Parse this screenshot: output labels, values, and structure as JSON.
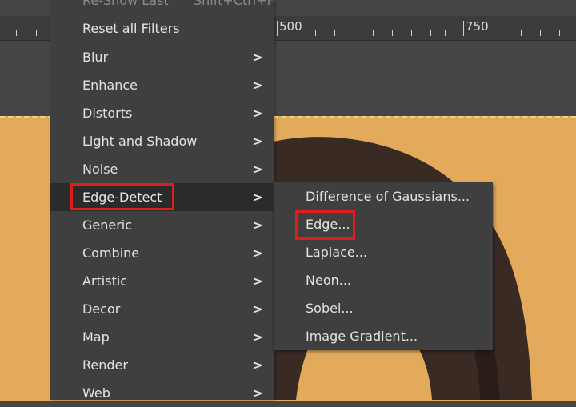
{
  "ruler": {
    "labels": [
      "500",
      "750"
    ]
  },
  "filters_menu": {
    "top_item": {
      "label": "Re-Show Last",
      "shortcut": "Shift+Ctrl+F"
    },
    "reset_label": "Reset all Filters",
    "items": [
      {
        "label": "Blur"
      },
      {
        "label": "Enhance"
      },
      {
        "label": "Distorts"
      },
      {
        "label": "Light and Shadow"
      },
      {
        "label": "Noise"
      },
      {
        "label": "Edge-Detect"
      },
      {
        "label": "Generic"
      },
      {
        "label": "Combine"
      },
      {
        "label": "Artistic"
      },
      {
        "label": "Decor"
      },
      {
        "label": "Map"
      },
      {
        "label": "Render"
      },
      {
        "label": "Web"
      }
    ],
    "submenu_arrow": ">"
  },
  "edge_detect_submenu": {
    "items": [
      {
        "label": "Difference of Gaussians..."
      },
      {
        "label": "Edge..."
      },
      {
        "label": "Laplace..."
      },
      {
        "label": "Neon..."
      },
      {
        "label": "Sobel..."
      },
      {
        "label": "Image Gradient..."
      }
    ]
  },
  "colors": {
    "menu_bg": "#3f3f3f",
    "canvas": "#e2aa5a",
    "highlight_box": "#e01d1d"
  }
}
